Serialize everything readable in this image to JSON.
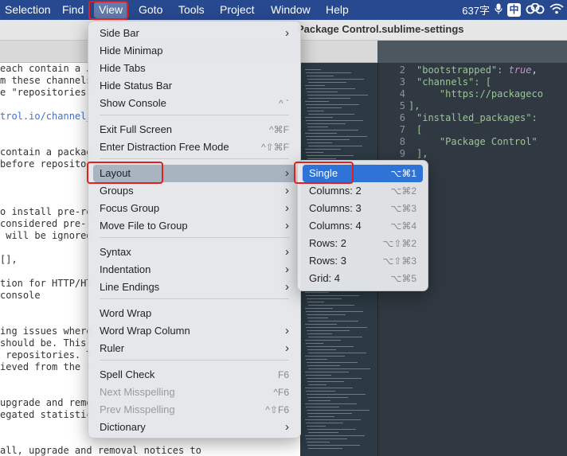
{
  "menubar": {
    "items": [
      "Selection",
      "Find",
      "View",
      "Goto",
      "Tools",
      "Project",
      "Window",
      "Help"
    ],
    "status": {
      "input_method_count": "637字",
      "zh": "中"
    }
  },
  "window": {
    "title": "Package Control.sublime-settings"
  },
  "left_code": [
    {
      "text": "each contain a J",
      "link": false
    },
    {
      "text": "m these channels",
      "link": false
    },
    {
      "text": "e \"repositories\"",
      "link": false
    },
    {
      "text": "",
      "link": false
    },
    {
      "text": "trol.io/channel_",
      "link": true
    },
    {
      "text": "",
      "link": false
    },
    {
      "text": "",
      "link": false
    },
    {
      "text": "contain a packag",
      "link": false
    },
    {
      "text": "before repositor",
      "link": false
    },
    {
      "text": "",
      "link": false
    },
    {
      "text": "",
      "link": false
    },
    {
      "text": "",
      "link": false
    },
    {
      "text": "o install pre-re",
      "link": false
    },
    {
      "text": "considered pre-r",
      "link": false
    },
    {
      "text": " will be ignored",
      "link": false
    },
    {
      "text": "",
      "link": false
    },
    {
      "text": "[],",
      "link": false
    },
    {
      "text": "",
      "link": false
    },
    {
      "text": "tion for HTTP/HT",
      "link": false
    },
    {
      "text": "console",
      "link": false
    },
    {
      "text": "",
      "link": false
    },
    {
      "text": "",
      "link": false
    },
    {
      "text": "ing issues where",
      "link": false
    },
    {
      "text": "should be. This",
      "link": false
    },
    {
      "text": " repositories. T",
      "link": false
    },
    {
      "text": "ieved from the r",
      "link": false
    },
    {
      "text": "",
      "link": false
    },
    {
      "text": "",
      "link": false
    },
    {
      "text": "upgrade and remo",
      "link": false
    },
    {
      "text": "egated statistic",
      "link": false
    },
    {
      "text": "",
      "link": false
    },
    {
      "text": "",
      "link": false
    },
    {
      "text": "all, upgrade and removal notices to",
      "link": false
    }
  ],
  "right_code": [
    {
      "num": "2",
      "text": [
        "\"bootstrapped\": ",
        "true",
        ","
      ]
    },
    {
      "num": "3",
      "text": [
        "\"channels\": [",
        "",
        ""
      ]
    },
    {
      "num": "4",
      "text": [
        "    \"https://packageco",
        "",
        ""
      ]
    },
    {
      "num": "5",
      "text": [
        "],",
        "",
        ""
      ]
    },
    {
      "num": "6",
      "text": [
        "\"installed_packages\":",
        "",
        ""
      ]
    },
    {
      "num": "7",
      "text": [
        "[",
        "",
        ""
      ]
    },
    {
      "num": "8",
      "text": [
        "    \"Package Control\"",
        "",
        ""
      ]
    },
    {
      "num": "9",
      "text": [
        "],",
        "",
        ""
      ]
    }
  ],
  "view_menu": {
    "items": [
      {
        "label": "Side Bar",
        "shortcut": "",
        "submenu": true,
        "disabled": false
      },
      {
        "label": "Hide Minimap",
        "shortcut": "",
        "submenu": false,
        "disabled": false
      },
      {
        "label": "Hide Tabs",
        "shortcut": "",
        "submenu": false,
        "disabled": false
      },
      {
        "label": "Hide Status Bar",
        "shortcut": "",
        "submenu": false,
        "disabled": false
      },
      {
        "label": "Show Console",
        "shortcut": "^ `",
        "submenu": false,
        "disabled": false
      },
      {
        "label": "Exit Full Screen",
        "shortcut": "^⌘F",
        "submenu": false,
        "disabled": false
      },
      {
        "label": "Enter Distraction Free Mode",
        "shortcut": "^⇧⌘F",
        "submenu": false,
        "disabled": false
      },
      {
        "label": "Layout",
        "shortcut": "",
        "submenu": true,
        "disabled": false
      },
      {
        "label": "Groups",
        "shortcut": "",
        "submenu": true,
        "disabled": false
      },
      {
        "label": "Focus Group",
        "shortcut": "",
        "submenu": true,
        "disabled": false
      },
      {
        "label": "Move File to Group",
        "shortcut": "",
        "submenu": true,
        "disabled": false
      },
      {
        "label": "Syntax",
        "shortcut": "",
        "submenu": true,
        "disabled": false
      },
      {
        "label": "Indentation",
        "shortcut": "",
        "submenu": true,
        "disabled": false
      },
      {
        "label": "Line Endings",
        "shortcut": "",
        "submenu": true,
        "disabled": false
      },
      {
        "label": "Word Wrap",
        "shortcut": "",
        "submenu": false,
        "disabled": false
      },
      {
        "label": "Word Wrap Column",
        "shortcut": "",
        "submenu": true,
        "disabled": false
      },
      {
        "label": "Ruler",
        "shortcut": "",
        "submenu": true,
        "disabled": false
      },
      {
        "label": "Spell Check",
        "shortcut": "F6",
        "submenu": false,
        "disabled": false
      },
      {
        "label": "Next Misspelling",
        "shortcut": "^F6",
        "submenu": false,
        "disabled": true
      },
      {
        "label": "Prev Misspelling",
        "shortcut": "^⇧F6",
        "submenu": false,
        "disabled": true
      },
      {
        "label": "Dictionary",
        "shortcut": "",
        "submenu": true,
        "disabled": false
      }
    ],
    "highlighted": "Layout"
  },
  "layout_submenu": {
    "items": [
      {
        "label": "Single",
        "shortcut": "⌥⌘1"
      },
      {
        "label": "Columns: 2",
        "shortcut": "⌥⌘2"
      },
      {
        "label": "Columns: 3",
        "shortcut": "⌥⌘3"
      },
      {
        "label": "Columns: 4",
        "shortcut": "⌥⌘4"
      },
      {
        "label": "Rows: 2",
        "shortcut": "⌥⇧⌘2"
      },
      {
        "label": "Rows: 3",
        "shortcut": "⌥⇧⌘3"
      },
      {
        "label": "Grid: 4",
        "shortcut": "⌥⌘5"
      }
    ],
    "selected": "Single"
  },
  "colors": {
    "highlight": "#a9b4c1",
    "selection": "#2f73d6",
    "annotation": "#e0201e"
  }
}
